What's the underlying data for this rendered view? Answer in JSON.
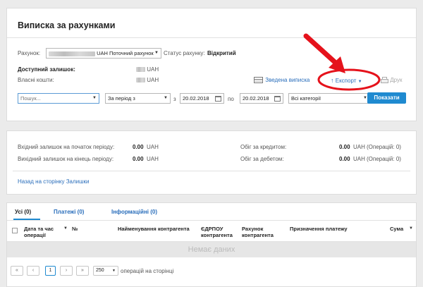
{
  "page_title": "Виписка за рахунками",
  "account": {
    "label": "Рахунок:",
    "select_value": "UAH Поточний рахунок",
    "status_label": "Статус рахунку:",
    "status_value": "Відкритий"
  },
  "balance": {
    "available_label": "Доступний залишок:",
    "own_funds_label": "Власні кошти:",
    "currency": "UAH"
  },
  "toolbar": {
    "summary_label": "Зведена виписка",
    "export_label": "Експорт",
    "print_label": "Друк"
  },
  "filters": {
    "search_placeholder": "Пошук...",
    "period_value": "За період з",
    "from_label": "з",
    "from_date": "20.02.2018",
    "to_label": "по",
    "to_date": "20.02.2018",
    "category_value": "Всі категорії",
    "show_button": "Показати"
  },
  "summary": {
    "opening_label": "Вхідний залишок на початок періоду:",
    "opening_value": "0.00",
    "closing_label": "Вихідний залишок на кінець періоду:",
    "closing_value": "0.00",
    "credit_label": "Обіг за кредитом:",
    "credit_value": "0.00",
    "credit_ops": "(Операцій: 0)",
    "debit_label": "Обіг за дебетом:",
    "debit_value": "0.00",
    "debit_ops": "(Операцій: 0)",
    "currency": "UAH",
    "back_link": "Назад на сторінку Залишки"
  },
  "tabs": [
    {
      "label": "Усі (0)"
    },
    {
      "label": "Платежі (0)"
    },
    {
      "label": "Інформаційні (0)"
    }
  ],
  "table": {
    "columns": [
      "Дата та час операції",
      "№",
      "Найменування контрагента",
      "ЄДРПОУ контрагента",
      "Рахунок контрагента",
      "Призначення платежу",
      "Сума"
    ],
    "empty_text": "Немає даних"
  },
  "pagination": {
    "first": "«",
    "prev": "‹",
    "current_page": "1",
    "next": "›",
    "last": "»",
    "page_size": "250",
    "page_size_label": "операцій на сторінці"
  },
  "colors": {
    "accent": "#1f8ad0",
    "link": "#2a6ebb",
    "annotation_red": "#e5121b"
  }
}
